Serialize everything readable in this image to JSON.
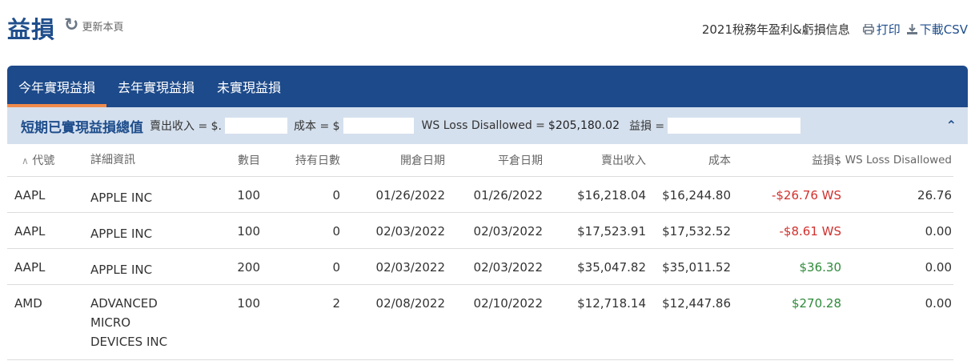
{
  "page": {
    "title": "益損",
    "refresh_label": "更新本頁"
  },
  "top_links": {
    "summary": "2021稅務年盈利&虧損信息",
    "print_label": "打印",
    "download_label": "下載CSV"
  },
  "tabs": [
    {
      "label": "今年實現益損",
      "active": true
    },
    {
      "label": "去年實現益損",
      "active": false
    },
    {
      "label": "未實現益損",
      "active": false
    }
  ],
  "section": {
    "title": "短期已實現益損總值",
    "proceeds_label": "賣出收入 = $.",
    "cost_label": "成本 = $",
    "ws_label": "WS Loss Disallowed = ",
    "ws_value": "$205,180.02",
    "gain_label": "益損 ="
  },
  "table": {
    "headers": {
      "symbol": "代號",
      "description": "詳細資訊",
      "quantity": "數目",
      "days_held": "持有日數",
      "open_date": "開倉日期",
      "close_date": "平倉日期",
      "proceeds": "賣出收入",
      "cost": "成本",
      "gain": "益損$",
      "ws_loss": "WS Loss Disallowed"
    },
    "rows": [
      {
        "symbol": "AAPL",
        "description": "APPLE INC",
        "quantity": "100",
        "days_held": "0",
        "open_date": "01/26/2022",
        "close_date": "01/26/2022",
        "proceeds": "$16,218.04",
        "cost": "$16,244.80",
        "gain": "-$26.76 WS",
        "ws_loss": "26.76"
      },
      {
        "symbol": "AAPL",
        "description": "APPLE INC",
        "quantity": "100",
        "days_held": "0",
        "open_date": "02/03/2022",
        "close_date": "02/03/2022",
        "proceeds": "$17,523.91",
        "cost": "$17,532.52",
        "gain": "-$8.61 WS",
        "ws_loss": "0.00"
      },
      {
        "symbol": "AAPL",
        "description": "APPLE INC",
        "quantity": "200",
        "days_held": "0",
        "open_date": "02/03/2022",
        "close_date": "02/03/2022",
        "proceeds": "$35,047.82",
        "cost": "$35,011.52",
        "gain": "$36.30",
        "ws_loss": "0.00"
      },
      {
        "symbol": "AMD",
        "description": "ADVANCED MICRO DEVICES INC",
        "quantity": "100",
        "days_held": "2",
        "open_date": "02/08/2022",
        "close_date": "02/10/2022",
        "proceeds": "$12,718.14",
        "cost": "$12,447.86",
        "gain": "$270.28",
        "ws_loss": "0.00"
      }
    ]
  },
  "colors": {
    "brand": "#1f4e8c",
    "tab_bar": "#1d4a8a",
    "tab_active_underline": "#f08a4b",
    "section_bg": "#d5e0ee",
    "loss": "#d0312d",
    "gain": "#2f8a3a"
  },
  "icons": {
    "refresh": "refresh-icon",
    "print": "printer-icon",
    "download": "download-icon",
    "collapse": "chevron-up-icon",
    "sort": "sort-up-icon"
  }
}
